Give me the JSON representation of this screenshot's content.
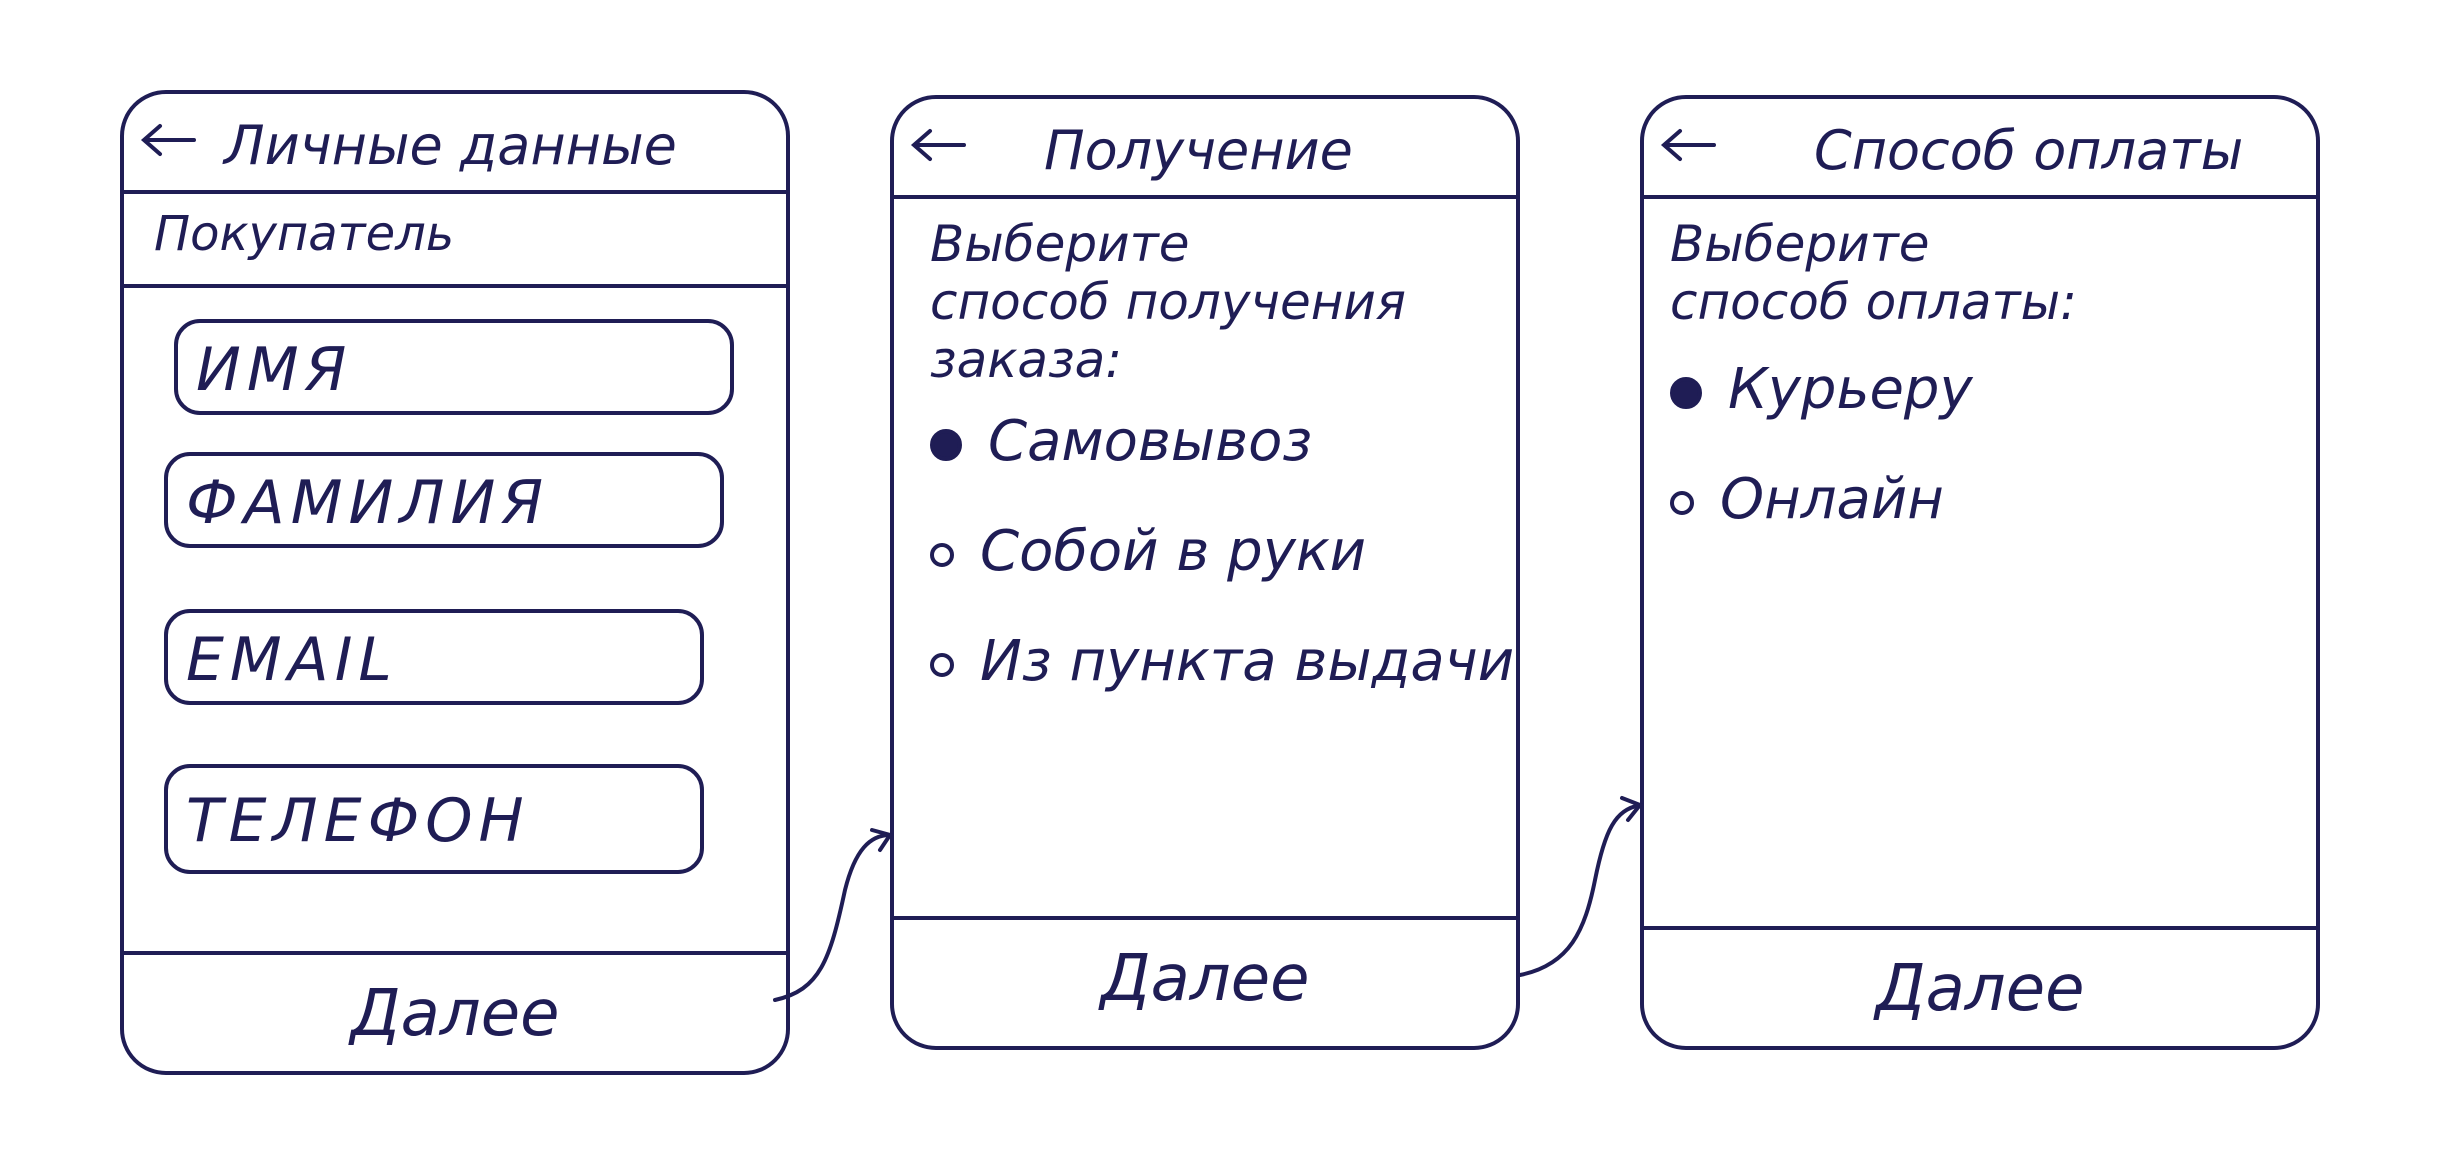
{
  "screens": [
    {
      "title": "Личные данные",
      "section_label": "Покупатель",
      "fields": [
        {
          "label": "ИМЯ"
        },
        {
          "label": "ФАМИЛИЯ"
        },
        {
          "label": "EMAIL"
        },
        {
          "label": "ТЕЛЕФОН"
        }
      ],
      "footer_button": "Далее"
    },
    {
      "title": "Получение",
      "prompt": "Выберите\nспособ получения\nзаказа:",
      "options": [
        {
          "label": "Самовывоз",
          "selected": true
        },
        {
          "label": "Собой в руки",
          "selected": false
        },
        {
          "label": "Из пункта выдачи",
          "selected": false
        }
      ],
      "footer_button": "Далее"
    },
    {
      "title": "Способ оплаты",
      "prompt": "Выберите\nспособ оплаты:",
      "options": [
        {
          "label": "Курьеру",
          "selected": true
        },
        {
          "label": "Онлайн",
          "selected": false
        }
      ],
      "footer_button": "Далее"
    }
  ],
  "colors": {
    "ink": "#1f1d55",
    "paper": "#ffffff"
  },
  "icons": {
    "back": "back-arrow-icon",
    "selected_radio": "radio-filled-icon",
    "empty_radio": "radio-empty-icon"
  }
}
